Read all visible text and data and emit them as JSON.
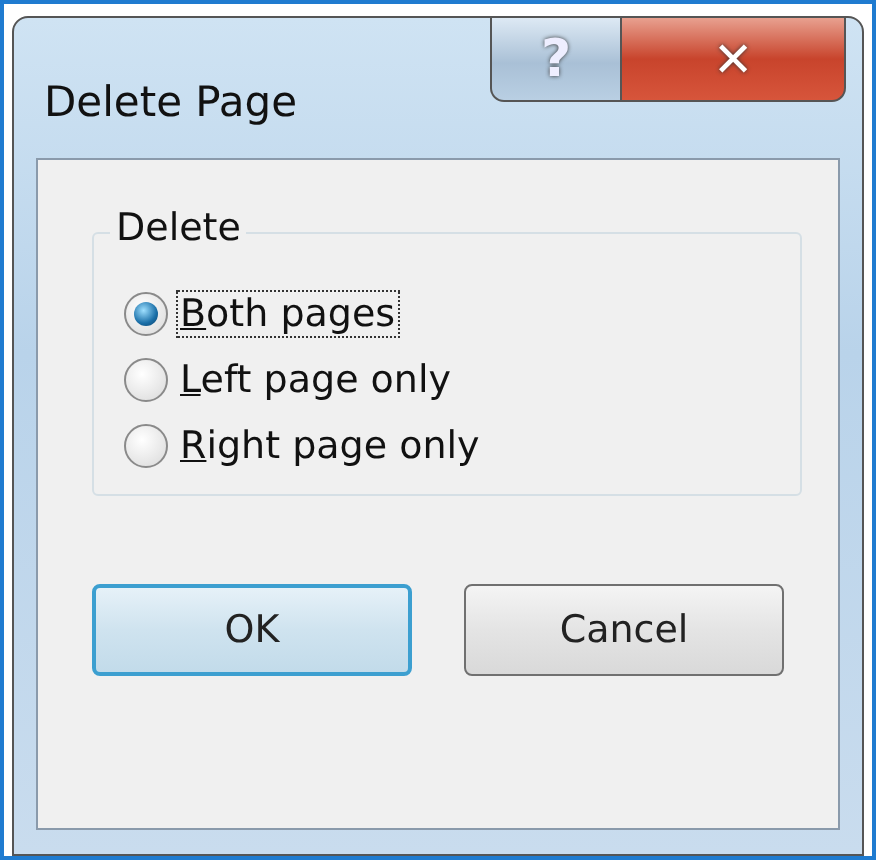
{
  "window": {
    "title": "Delete Page",
    "help_button": "?",
    "close_button": "✕"
  },
  "group": {
    "legend": "Delete",
    "options": [
      {
        "label": "Both pages",
        "selected": true,
        "focused": true,
        "access_key": true
      },
      {
        "label": "Left page only",
        "selected": false,
        "focused": false,
        "access_key": true
      },
      {
        "label": "Right page only",
        "selected": false,
        "focused": false,
        "access_key": true
      }
    ]
  },
  "buttons": [
    {
      "label": "OK",
      "default": true
    },
    {
      "label": "Cancel",
      "default": false
    }
  ]
}
